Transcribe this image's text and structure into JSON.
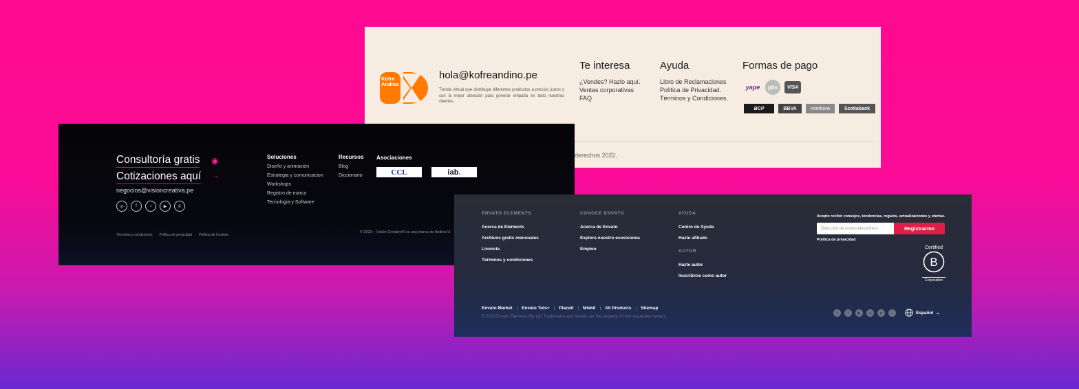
{
  "kofre": {
    "logo_text_1": "Kofre",
    "logo_text_2": "Andino",
    "logo_color": "#ff7a00",
    "email": "hola@kofreandino.pe",
    "description": "Tienda virtual que distribuye diferentes productos a precios justos y con la mejor atención para generar empatía en todo nuestros clientes.",
    "interesa": {
      "title": "Te interesa",
      "links": [
        "¿Vendes? Hazlo aquí.",
        "Ventas corporativas",
        "FAQ"
      ]
    },
    "ayuda": {
      "title": "Ayuda",
      "links": [
        "Libro de Reclamaciones",
        "Política de Privacidad.",
        "Términos y Condiciones."
      ]
    },
    "pago": {
      "title": "Formas de pago",
      "methods": [
        "yape",
        "plin",
        "VISA"
      ],
      "banks": [
        "BCP",
        "BBVA",
        "Interbank",
        "Scotiabank"
      ]
    },
    "copyright": "derechos 2022."
  },
  "vision": {
    "headline_1": "Consultoría gratis",
    "headline_2": "Cotizaciones aquí",
    "accent_color": "#ff1e8e",
    "email": "negocios@visioncreativa.pe",
    "socials": [
      "instagram-icon",
      "facebook-icon",
      "tiktok-icon",
      "youtube-icon",
      "whatsapp-icon"
    ],
    "soluciones": {
      "title": "Soluciones",
      "links": [
        "Diseño y animación",
        "Estrategia y comunicacion",
        "Workshops",
        "Registro de marca",
        "Tecnologia y Software"
      ]
    },
    "recursos": {
      "title": "Recursos",
      "links": [
        "Blog",
        "Diccionario"
      ]
    },
    "asociaciones": {
      "title": "Asociaciones",
      "ccl": "CCL",
      "iab": "iab"
    },
    "legal": [
      "Términos y condiciones",
      "Política de privacidad",
      "Política de Cookies"
    ],
    "copyright": "© 2023 – Visión Creative® es una marca de Andina U"
  },
  "envato": {
    "elements": {
      "title": "ENVATO ELEMENTS",
      "links": [
        "Acerca de Elements",
        "Archivos gratis mensuales",
        "Licencia",
        "Términos y condiciones"
      ]
    },
    "conoce": {
      "title": "CONOCE ENVATO",
      "links": [
        "Acerca de Envato",
        "Explora nuestro ecosistema",
        "Empleo"
      ]
    },
    "ayuda": {
      "title": "AYUDA",
      "links": [
        "Centro de Ayuda",
        "Hazte afiliado"
      ]
    },
    "autor": {
      "title": "AUTOR",
      "links": [
        "Hazte autor",
        "Inscribirse como autor"
      ]
    },
    "newsletter": {
      "offer": "Acepto recibir consejos, tendencias, regalos, actualizaciones y ofertas.",
      "placeholder": "Dirección de correo electrónico",
      "button": "Registrarme",
      "privacy": "Política de privacidad"
    },
    "bcorp": {
      "top": "Certified",
      "letter": "B",
      "bottom": "Corporation"
    },
    "bottom_links": [
      "Envato Market",
      "Envato Tuts+",
      "Placeit",
      "Mixkit",
      "All Products",
      "Sitemap"
    ],
    "copyright": "© 2023 Envato Elements Pty Ltd. Trademarks and brands are the property of their respective owners.",
    "socials": [
      "twitter-icon",
      "facebook-icon",
      "youtube-icon",
      "instagram-icon",
      "pinterest-icon",
      "tiktok-icon"
    ],
    "language": "Español",
    "accent_color": "#e11e49"
  }
}
